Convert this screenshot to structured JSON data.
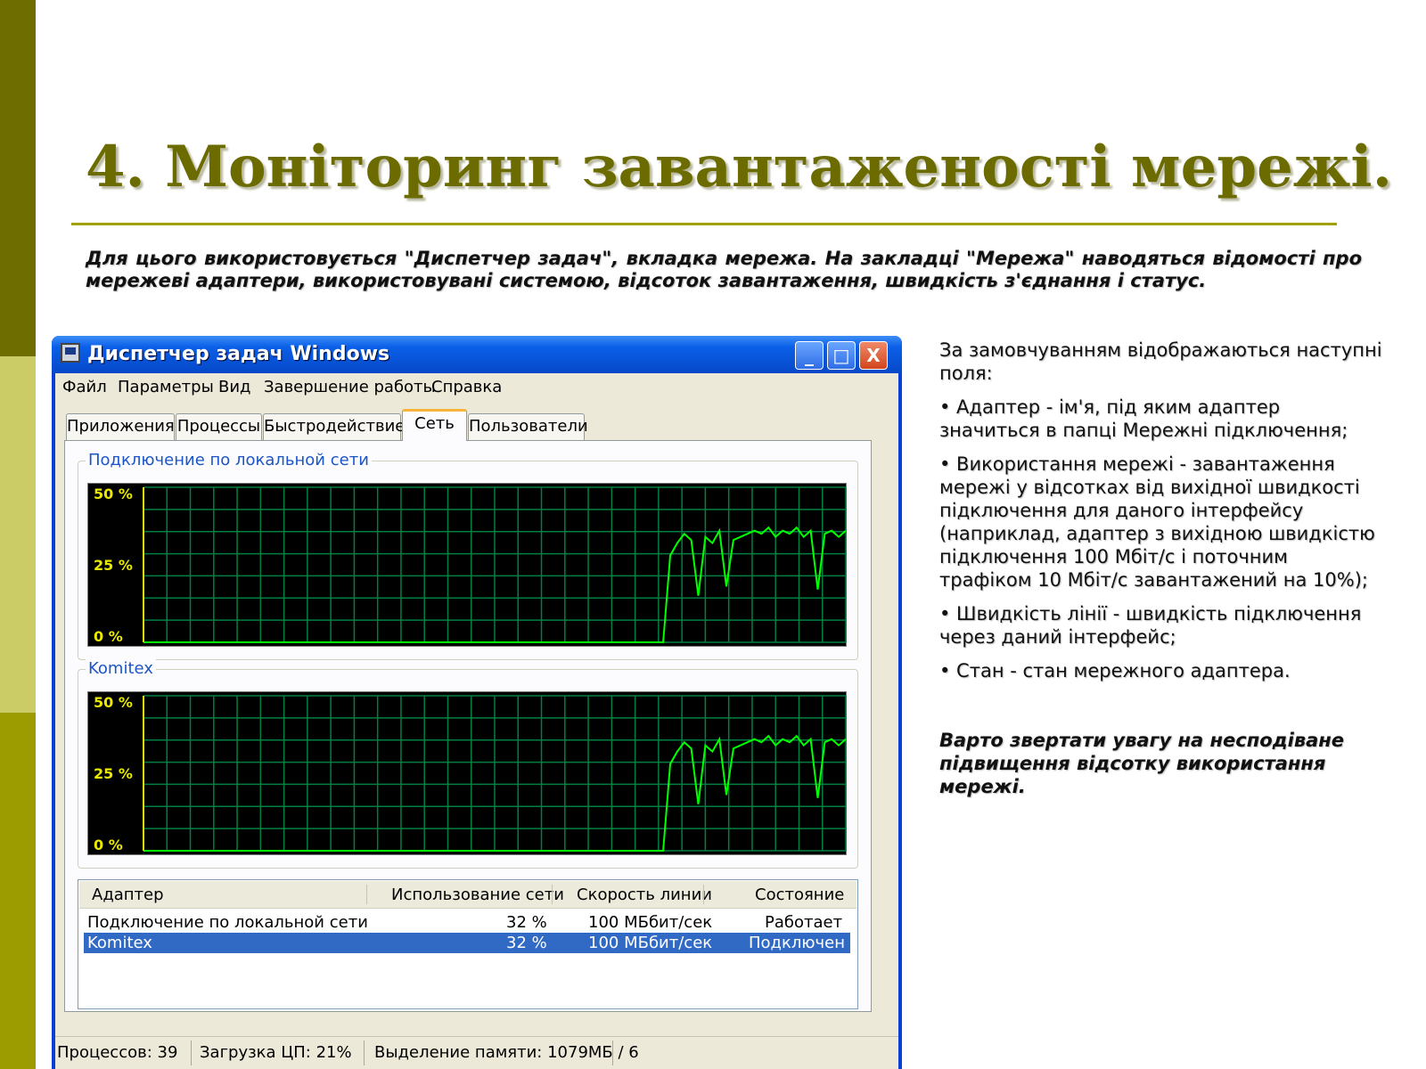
{
  "slide": {
    "title": "4. Моніторинг завантаженості мережі.",
    "intro": "Для цього використовується \"Диспетчер задач\", вкладка мережа. На закладці \"Мережа\" наводяться відомості про мережеві адаптери, використовувані системою, відсоток завантаження, швидкість з'єднання і статус.",
    "side_paragraphs": [
      "За замовчуванням відображаються наступні поля:",
      "• Адаптер - ім'я, під яким адаптер значиться в папці Мережні підключення;",
      "• Використання мережі - завантаження мережі у відсотках від вихідної швидкості підключення для даного інтерфейсу (наприклад, адаптер з вихідною швидкістю підключення 100 Мбіт/с і поточним трафіком 10 Мбіт/с завантажений на 10%);",
      "• Швидкість лінії - швидкість підключення через даний інтерфейс;",
      "• Стан - стан мережного адаптера."
    ],
    "warning": "Варто звертати увагу на несподіване підвищення відсотку використання мережі.",
    "colors": {
      "title": "#6b6b00",
      "bar_dark": "#6e6e00",
      "bar_light": "#cccc66",
      "bar_mid": "#9c9c00"
    }
  },
  "window": {
    "title": "Диспетчер задач Windows",
    "controls": {
      "minimize": "_",
      "maximize": "□",
      "close": "X"
    },
    "menu": [
      "Файл",
      "Параметры",
      "Вид",
      "Завершение работы",
      "Справка"
    ],
    "tabs": [
      "Приложения",
      "Процессы",
      "Быстродействие",
      "Сеть",
      "Пользователи"
    ],
    "active_tab": "Сеть",
    "graphs": [
      {
        "label": "Подключение по локальной сети",
        "y_labels": [
          "50 %",
          "25 %",
          "0 %"
        ]
      },
      {
        "label": "Komitex",
        "y_labels": [
          "50 %",
          "25 %",
          "0 %"
        ]
      }
    ],
    "table": {
      "headers": [
        "Адаптер",
        "Использование сети",
        "Скорость линии",
        "Состояние"
      ],
      "rows": [
        {
          "adapter": "Подключение по локальной сети",
          "usage": "32 %",
          "speed": "100 МБбит/сек",
          "state": "Работает"
        },
        {
          "adapter": "Komitex",
          "usage": "32 %",
          "speed": "100 МБбит/сек",
          "state": "Подключен"
        }
      ],
      "selected_row": 1
    },
    "statusbar": [
      "Процессов: 39",
      "Загрузка ЦП: 21%",
      "Выделение памяти: 1079МБ / 6"
    ],
    "colors": {
      "titlebar": "#0648c8",
      "graph_bg": "#000000",
      "grid": "#008040",
      "trace": "#00ff00",
      "axis_label": "#e8e800",
      "selection": "#316ac5"
    }
  },
  "chart_data": [
    {
      "type": "line",
      "title": "Подключение по локальной сети",
      "ylim": [
        0,
        50
      ],
      "y_ticks": [
        "0 %",
        "25 %",
        "50 %"
      ],
      "x": [
        0,
        5,
        10,
        15,
        20,
        25,
        30,
        35,
        40,
        45,
        50,
        55,
        60,
        65,
        70,
        72,
        74,
        75,
        76,
        77,
        78,
        79,
        80,
        81,
        82,
        83,
        84,
        85,
        86,
        87,
        88,
        89,
        90,
        91,
        92,
        93,
        94,
        95,
        96,
        97,
        98,
        99,
        100
      ],
      "values": [
        0,
        0,
        0,
        0,
        0,
        0,
        0,
        0,
        0,
        0,
        0,
        0,
        0,
        0,
        0,
        0,
        0,
        28,
        32,
        35,
        33,
        15,
        34,
        32,
        36,
        18,
        33,
        34,
        35,
        36,
        35,
        37,
        34,
        36,
        35,
        37,
        34,
        36,
        17,
        35,
        36,
        34,
        36
      ]
    },
    {
      "type": "line",
      "title": "Komitex",
      "ylim": [
        0,
        50
      ],
      "y_ticks": [
        "0 %",
        "25 %",
        "50 %"
      ],
      "x": [
        0,
        5,
        10,
        15,
        20,
        25,
        30,
        35,
        40,
        45,
        50,
        55,
        60,
        65,
        70,
        72,
        74,
        75,
        76,
        77,
        78,
        79,
        80,
        81,
        82,
        83,
        84,
        85,
        86,
        87,
        88,
        89,
        90,
        91,
        92,
        93,
        94,
        95,
        96,
        97,
        98,
        99,
        100
      ],
      "values": [
        0,
        0,
        0,
        0,
        0,
        0,
        0,
        0,
        0,
        0,
        0,
        0,
        0,
        0,
        0,
        0,
        0,
        28,
        32,
        35,
        33,
        15,
        34,
        32,
        36,
        18,
        33,
        34,
        35,
        36,
        35,
        37,
        34,
        36,
        35,
        37,
        34,
        36,
        17,
        35,
        36,
        34,
        36
      ]
    }
  ]
}
